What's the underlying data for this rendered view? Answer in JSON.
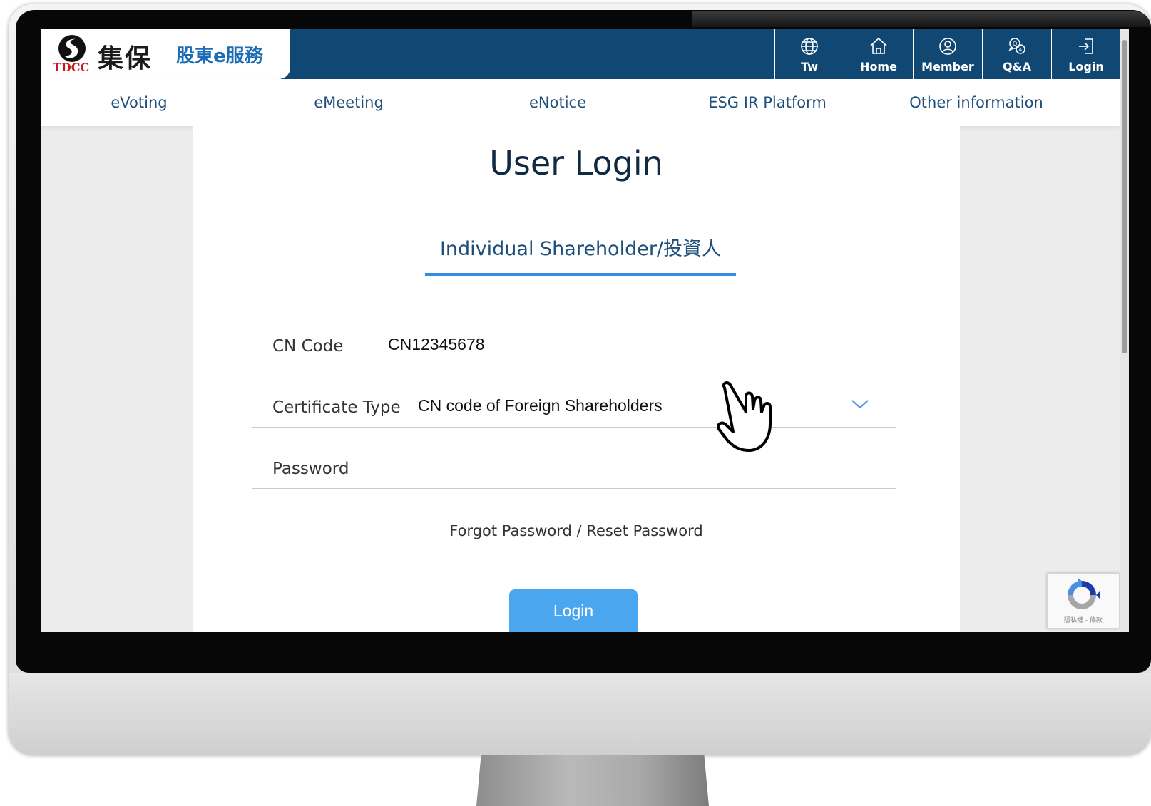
{
  "header": {
    "logo_tdcc": "TDCC",
    "logo_chinese": "集保",
    "service_name": "股東e服務",
    "actions": [
      {
        "label": "Tw",
        "icon": "globe-icon"
      },
      {
        "label": "Home",
        "icon": "home-icon"
      },
      {
        "label": "Member",
        "icon": "user-icon"
      },
      {
        "label": "Q&A",
        "icon": "chat-icon"
      },
      {
        "label": "Login",
        "icon": "login-icon"
      }
    ]
  },
  "nav": {
    "items": [
      "eVoting",
      "eMeeting",
      "eNotice",
      "ESG IR Platform",
      "Other information"
    ]
  },
  "login": {
    "title": "User Login",
    "active_tab": "Individual Shareholder/投資人",
    "cn_code_label": "CN Code",
    "cn_code_value": "CN12345678",
    "cert_type_label": "Certificate Type",
    "cert_type_value": "CN code of Foreign Shareholders",
    "password_label": "Password",
    "forgot_link": "Forgot Password / Reset Password",
    "login_button": "Login"
  },
  "recaptcha": {
    "text": "隱私權 - 條款"
  },
  "colors": {
    "header_bg": "#114873",
    "accent_blue": "#2f8ee0",
    "button_blue": "#4aa6ee",
    "logo_red": "#c8171e",
    "service_blue": "#1c6db5"
  }
}
